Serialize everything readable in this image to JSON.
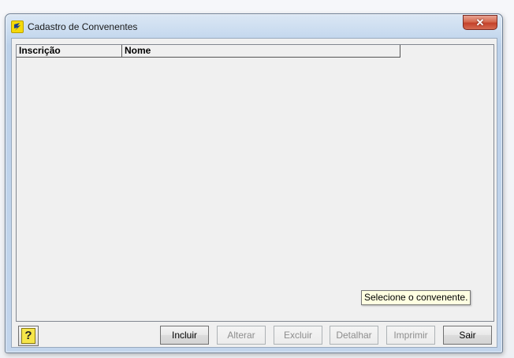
{
  "window": {
    "title": "Cadastro de Convenentes",
    "close_symbol": "✕",
    "app_icon": "bank-logo-icon"
  },
  "list": {
    "columns": [
      "Inscrição",
      "Nome"
    ],
    "rows": []
  },
  "tooltip": "Selecione o convenente.",
  "help": {
    "symbol": "?",
    "icon": "help-icon"
  },
  "buttons": {
    "incluir": "Incluir",
    "alterar": "Alterar",
    "excluir": "Excluir",
    "detalhar": "Detalhar",
    "imprimir": "Imprimir",
    "sair": "Sair"
  },
  "colors": {
    "close_red": "#c4422b",
    "tooltip_bg": "#ffffe1",
    "icon_yellow": "#f5d90a",
    "client_bg": "#f0f0f0"
  }
}
